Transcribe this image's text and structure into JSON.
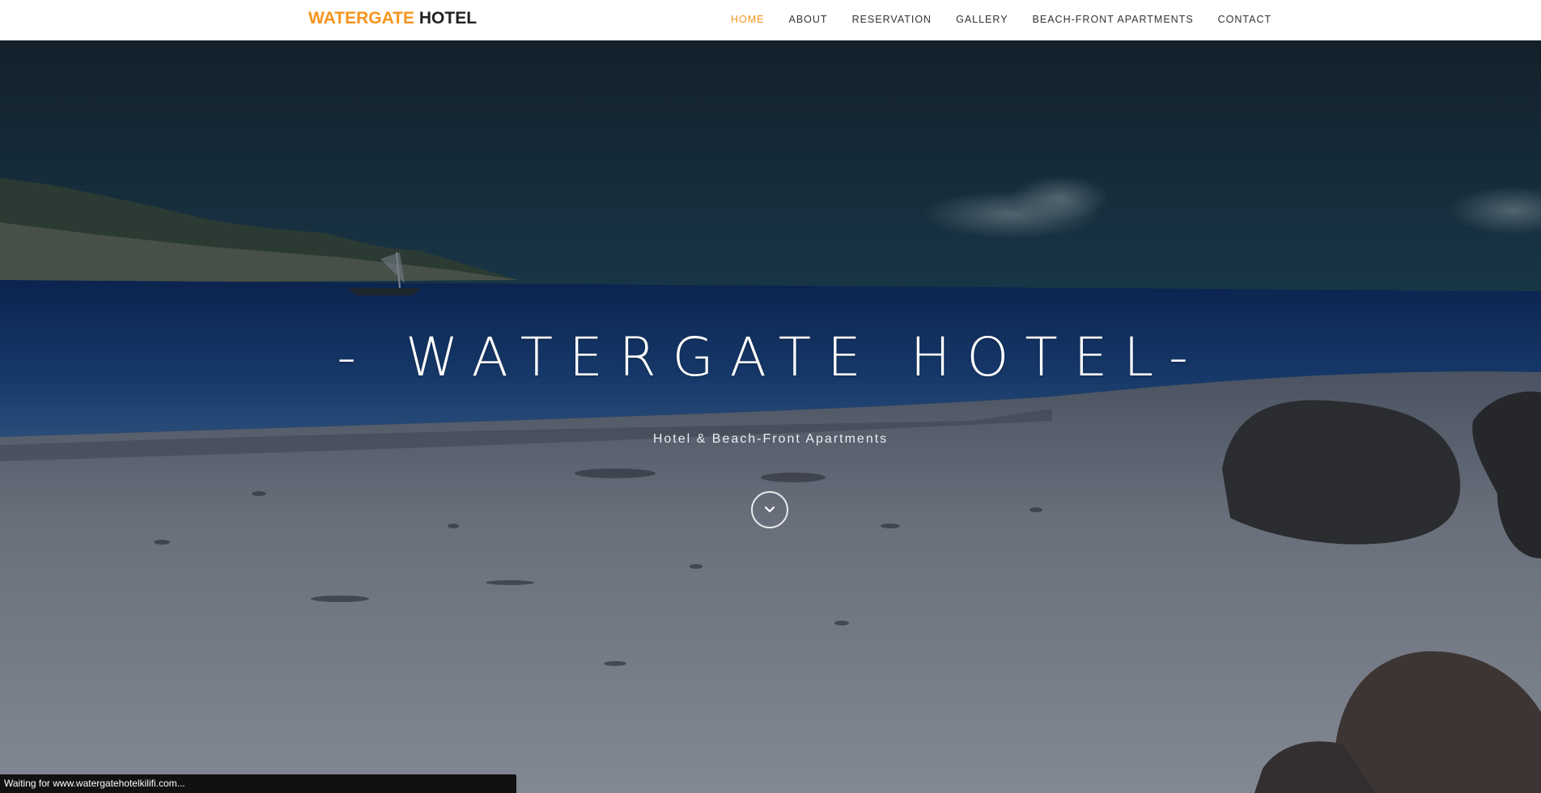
{
  "brand": {
    "part1": "WATERGATE",
    "part2": "HOTEL",
    "accent_color": "#f7941d"
  },
  "nav": {
    "items": [
      {
        "label": "HOME",
        "active": true
      },
      {
        "label": "ABOUT",
        "active": false
      },
      {
        "label": "RESERVATION",
        "active": false
      },
      {
        "label": "GALLERY",
        "active": false
      },
      {
        "label": "BEACH-FRONT APARTMENTS",
        "active": false
      },
      {
        "label": "CONTACT",
        "active": false
      }
    ]
  },
  "hero": {
    "title": "- WATERGATE HOTEL-",
    "subtitle": "Hotel & Beach-Front Apartments",
    "scroll_icon": "chevron-down-icon"
  },
  "status_bar": {
    "text": "Waiting for www.watergatehotelkilifi.com..."
  }
}
